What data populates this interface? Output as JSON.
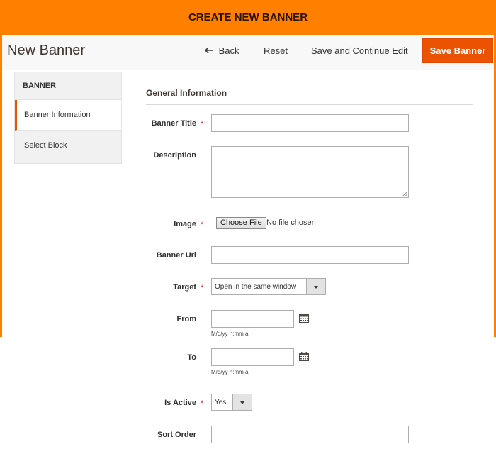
{
  "window_title": "CREATE NEW BANNER",
  "header": {
    "title": "New Banner",
    "back_label": "Back",
    "reset_label": "Reset",
    "save_continue_label": "Save and Continue Edit",
    "save_label": "Save Banner"
  },
  "sidebar": {
    "heading": "BANNER",
    "items": [
      {
        "label": "Banner Information",
        "active": true
      },
      {
        "label": "Select Block",
        "active": false
      }
    ]
  },
  "form": {
    "section_title": "General Information",
    "banner_title": {
      "label": "Banner Title",
      "value": ""
    },
    "description": {
      "label": "Description",
      "value": ""
    },
    "image": {
      "label": "Image",
      "button_label": "Choose File",
      "status": "No file chosen"
    },
    "banner_url": {
      "label": "Banner Url",
      "value": ""
    },
    "target": {
      "label": "Target",
      "selected": "Open in the same window"
    },
    "from": {
      "label": "From",
      "value": "",
      "hint": "M/d/yy h:mm a"
    },
    "to": {
      "label": "To",
      "value": "",
      "hint": "M/d/yy h:mm a"
    },
    "is_active": {
      "label": "Is Active",
      "selected": "Yes"
    },
    "sort_order": {
      "label": "Sort Order",
      "value": ""
    },
    "required_mark": "*"
  },
  "colors": {
    "brand_orange": "#ff7f00",
    "save_button": "#eb5202",
    "required_star": "#e22626"
  },
  "icons": {
    "back": "arrow-left-icon",
    "calendar": "calendar-icon",
    "select": "chevron-down-icon"
  }
}
